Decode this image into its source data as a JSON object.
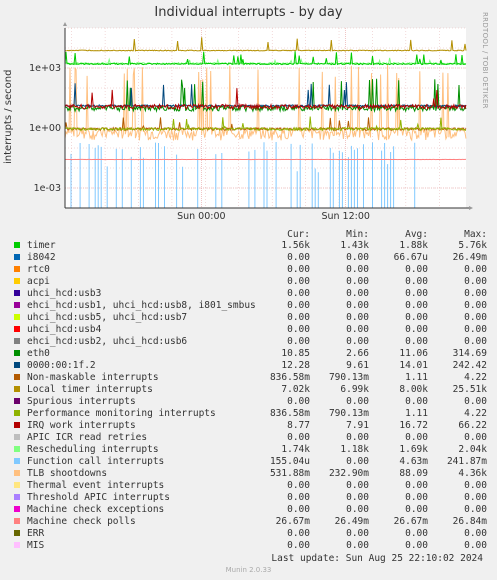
{
  "title": "Individual interrupts - by day",
  "side_label": "RRDTOOL / TOBI OETIKER",
  "y_label": "interrupts / second",
  "chart_data": {
    "type": "line",
    "title": "Individual interrupts - by day",
    "ylabel": "interrupts / second",
    "yscale": "log",
    "ylim": [
      0.0001,
      100000
    ],
    "y_ticks": [
      "1e+03",
      "1e+00",
      "1e-03"
    ],
    "x_ticks": [
      "Sun 00:00",
      "Sun 12:00"
    ],
    "grid": true,
    "series_summary": [
      {
        "name": "Local timer interrupts",
        "level": 7020
      },
      {
        "name": "Rescheduling interrupts",
        "level": 1740
      },
      {
        "name": "timer",
        "level": 1560
      },
      {
        "name": "IRQ work interrupts",
        "level": 8.77
      },
      {
        "name": "eth0",
        "level": 10.85
      },
      {
        "name": "0000:00:1f.2",
        "level": 12.28
      },
      {
        "name": "Machine check polls",
        "level": 0.02667
      }
    ]
  },
  "legend": {
    "headers": {
      "cur": "Cur:",
      "min": "Min:",
      "avg": "Avg:",
      "max": "Max:"
    },
    "rows": [
      {
        "label": "timer",
        "color": "#00cc00",
        "cur": "1.56k",
        "min": "1.43k",
        "avg": "1.88k",
        "max": "5.76k"
      },
      {
        "label": "i8042",
        "color": "#0066b3",
        "cur": "0.00",
        "min": "0.00",
        "avg": "66.67u",
        "max": "26.49m"
      },
      {
        "label": "rtc0",
        "color": "#ff8000",
        "cur": "0.00",
        "min": "0.00",
        "avg": "0.00",
        "max": "0.00"
      },
      {
        "label": "acpi",
        "color": "#ffcc00",
        "cur": "0.00",
        "min": "0.00",
        "avg": "0.00",
        "max": "0.00"
      },
      {
        "label": "uhci_hcd:usb3",
        "color": "#330099",
        "cur": "0.00",
        "min": "0.00",
        "avg": "0.00",
        "max": "0.00"
      },
      {
        "label": "ehci_hcd:usb1, uhci_hcd:usb8, i801_smbus",
        "color": "#990099",
        "cur": "0.00",
        "min": "0.00",
        "avg": "0.00",
        "max": "0.00"
      },
      {
        "label": "uhci_hcd:usb5, uhci_hcd:usb7",
        "color": "#ccff00",
        "cur": "0.00",
        "min": "0.00",
        "avg": "0.00",
        "max": "0.00"
      },
      {
        "label": "uhci_hcd:usb4",
        "color": "#ff0000",
        "cur": "0.00",
        "min": "0.00",
        "avg": "0.00",
        "max": "0.00"
      },
      {
        "label": "ehci_hcd:usb2, uhci_hcd:usb6",
        "color": "#808080",
        "cur": "0.00",
        "min": "0.00",
        "avg": "0.00",
        "max": "0.00"
      },
      {
        "label": "eth0",
        "color": "#008f00",
        "cur": "10.85",
        "min": "2.66",
        "avg": "11.06",
        "max": "314.69"
      },
      {
        "label": "0000:00:1f.2",
        "color": "#00487d",
        "cur": "12.28",
        "min": "9.61",
        "avg": "14.01",
        "max": "242.42"
      },
      {
        "label": "Non-maskable interrupts",
        "color": "#b35a00",
        "cur": "836.58m",
        "min": "790.13m",
        "avg": "1.11",
        "max": "4.22"
      },
      {
        "label": "Local timer interrupts",
        "color": "#b38f00",
        "cur": "7.02k",
        "min": "6.99k",
        "avg": "8.00k",
        "max": "25.51k"
      },
      {
        "label": "Spurious interrupts",
        "color": "#6b006b",
        "cur": "0.00",
        "min": "0.00",
        "avg": "0.00",
        "max": "0.00"
      },
      {
        "label": "Performance monitoring interrupts",
        "color": "#8fb300",
        "cur": "836.58m",
        "min": "790.13m",
        "avg": "1.11",
        "max": "4.22"
      },
      {
        "label": "IRQ work interrupts",
        "color": "#b30000",
        "cur": "8.77",
        "min": "7.91",
        "avg": "16.72",
        "max": "66.22"
      },
      {
        "label": "APIC ICR read retries",
        "color": "#bebebe",
        "cur": "0.00",
        "min": "0.00",
        "avg": "0.00",
        "max": "0.00"
      },
      {
        "label": "Rescheduling interrupts",
        "color": "#80ff80",
        "cur": "1.74k",
        "min": "1.18k",
        "avg": "1.69k",
        "max": "2.04k"
      },
      {
        "label": "Function call interrupts",
        "color": "#80c9ff",
        "cur": "155.04u",
        "min": "0.00",
        "avg": "4.63m",
        "max": "241.87m"
      },
      {
        "label": "TLB shootdowns",
        "color": "#ffc080",
        "cur": "531.88m",
        "min": "232.90m",
        "avg": "88.09",
        "max": "4.36k"
      },
      {
        "label": "Thermal event interrupts",
        "color": "#ffe680",
        "cur": "0.00",
        "min": "0.00",
        "avg": "0.00",
        "max": "0.00"
      },
      {
        "label": "Threshold APIC interrupts",
        "color": "#aa80ff",
        "cur": "0.00",
        "min": "0.00",
        "avg": "0.00",
        "max": "0.00"
      },
      {
        "label": "Machine check exceptions",
        "color": "#ee00cc",
        "cur": "0.00",
        "min": "0.00",
        "avg": "0.00",
        "max": "0.00"
      },
      {
        "label": "Machine check polls",
        "color": "#ff8080",
        "cur": "26.67m",
        "min": "26.49m",
        "avg": "26.67m",
        "max": "26.84m"
      },
      {
        "label": "ERR",
        "color": "#666600",
        "cur": "0.00",
        "min": "0.00",
        "avg": "0.00",
        "max": "0.00"
      },
      {
        "label": "MIS",
        "color": "#ffbfff",
        "cur": "0.00",
        "min": "0.00",
        "avg": "0.00",
        "max": "0.00"
      }
    ]
  },
  "last_update": "Last update:  Sun Aug 25 22:10:02 2024",
  "footer": "Munin 2.0.33"
}
